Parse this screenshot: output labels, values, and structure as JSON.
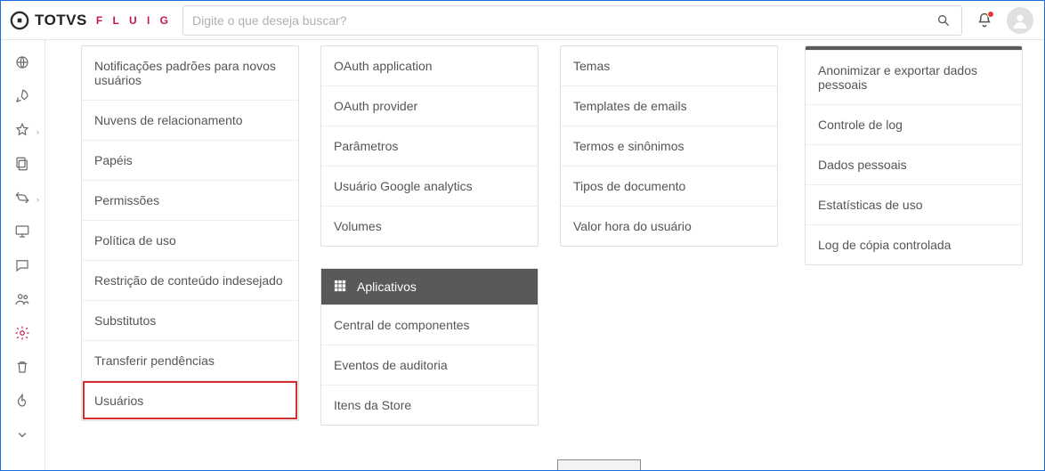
{
  "header": {
    "brand_primary": "TOTVS",
    "brand_secondary": "F L U I G",
    "search_placeholder": "Digite o que deseja buscar?"
  },
  "columns": {
    "col1": {
      "items": [
        "Notificações padrões para novos usuários",
        "Nuvens de relacionamento",
        "Papéis",
        "Permissões",
        "Política de uso",
        "Restrição de conteúdo indesejado",
        "Substitutos",
        "Transferir pendências",
        "Usuários"
      ],
      "highlight": "Usuários"
    },
    "col2": {
      "group1_items": [
        "OAuth application",
        "OAuth provider",
        "Parâmetros",
        "Usuário Google analytics",
        "Volumes"
      ],
      "group2_header": "Aplicativos",
      "group2_items": [
        "Central de componentes",
        "Eventos de auditoria",
        "Itens da Store"
      ]
    },
    "col3": {
      "items": [
        "Temas",
        "Templates de emails",
        "Termos e sinônimos",
        "Tipos de documento",
        "Valor hora do usuário"
      ]
    },
    "col4": {
      "items": [
        "Anonimizar e exportar dados pessoais",
        "Controle de log",
        "Dados pessoais",
        "Estatísticas de uso",
        "Log de cópia controlada"
      ]
    }
  },
  "sidebar_icons": [
    {
      "name": "globe-icon",
      "chev": false
    },
    {
      "name": "rocket-icon",
      "chev": false
    },
    {
      "name": "star-icon",
      "chev": true
    },
    {
      "name": "copy-icon",
      "chev": false
    },
    {
      "name": "arrows-icon",
      "chev": true
    },
    {
      "name": "monitor-icon",
      "chev": false
    },
    {
      "name": "chat-icon",
      "chev": false
    },
    {
      "name": "people-icon",
      "chev": false
    },
    {
      "name": "gear-icon",
      "chev": false,
      "active": true
    },
    {
      "name": "trash-icon",
      "chev": false
    },
    {
      "name": "flame-icon",
      "chev": false
    },
    {
      "name": "more-icon",
      "chev": false
    }
  ]
}
